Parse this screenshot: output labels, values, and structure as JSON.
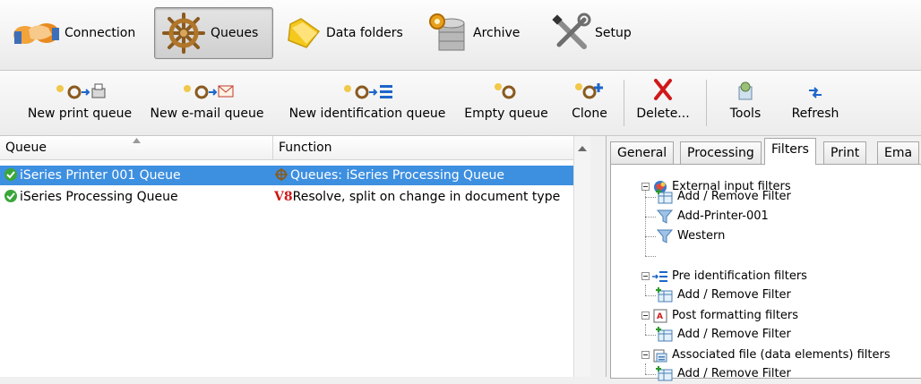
{
  "nav": {
    "items": [
      {
        "label": "Connection",
        "icon": "handshake-icon",
        "active": false
      },
      {
        "label": "Queues",
        "icon": "ship-wheel-icon",
        "active": true
      },
      {
        "label": "Data folders",
        "icon": "folder-icon",
        "active": false
      },
      {
        "label": "Archive",
        "icon": "database-gear-icon",
        "active": false
      },
      {
        "label": "Setup",
        "icon": "tools-icon",
        "active": false
      }
    ]
  },
  "toolbar": {
    "new_print_queue": "New print queue",
    "new_email_queue": "New e-mail queue",
    "new_identification_queue": "New identification queue",
    "empty_queue": "Empty queue",
    "clone": "Clone",
    "delete": "Delete...",
    "tools": "Tools",
    "refresh": "Refresh"
  },
  "grid": {
    "columns": [
      "Queue",
      "Function"
    ],
    "rows": [
      {
        "queue": "iSeries Printer 001 Queue",
        "function": "Queues: iSeries Processing Queue",
        "selected": true
      },
      {
        "queue": "iSeries Processing Queue",
        "function": "Resolve, split on change in document type",
        "function_badge": "V8",
        "selected": false
      }
    ]
  },
  "tabs": [
    "General",
    "Processing",
    "Filters",
    "Print",
    "Ema"
  ],
  "active_tab": "Filters",
  "tree": {
    "external": {
      "label": "External input filters",
      "children": [
        "Add / Remove Filter",
        "Add-Printer-001",
        "Western"
      ]
    },
    "pre_ident": {
      "label": "Pre identification filters",
      "children": [
        "Add / Remove Filter"
      ]
    },
    "post_fmt": {
      "label": "Post formatting filters",
      "children": [
        "Add / Remove Filter"
      ]
    },
    "assoc": {
      "label": "Associated file (data elements) filters",
      "children": [
        "Add / Remove Filter"
      ]
    }
  },
  "colors": {
    "selection": "#3d8fe0",
    "accent": "#0a64c8",
    "delete": "#d01818"
  }
}
